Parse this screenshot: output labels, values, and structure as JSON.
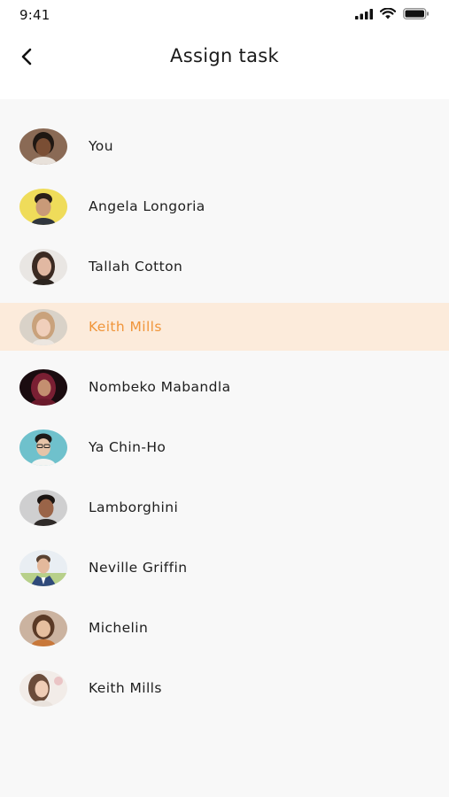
{
  "status_bar": {
    "time": "9:41"
  },
  "header": {
    "title": "Assign task",
    "back_icon": "chevron-left-icon"
  },
  "colors": {
    "accent": "#f0953a",
    "selected_row_bg": "#fcebdb",
    "list_bg": "#f8f8f8"
  },
  "assignees": [
    {
      "name": "You",
      "selected": false
    },
    {
      "name": "Angela Longoria",
      "selected": false
    },
    {
      "name": "Tallah Cotton",
      "selected": false
    },
    {
      "name": "Keith Mills",
      "selected": true
    },
    {
      "name": "Nombeko Mabandla",
      "selected": false
    },
    {
      "name": "Ya Chin-Ho",
      "selected": false
    },
    {
      "name": "Lamborghini",
      "selected": false
    },
    {
      "name": "Neville Griffin",
      "selected": false
    },
    {
      "name": "Michelin",
      "selected": false
    },
    {
      "name": "Keith Mills",
      "selected": false
    }
  ]
}
